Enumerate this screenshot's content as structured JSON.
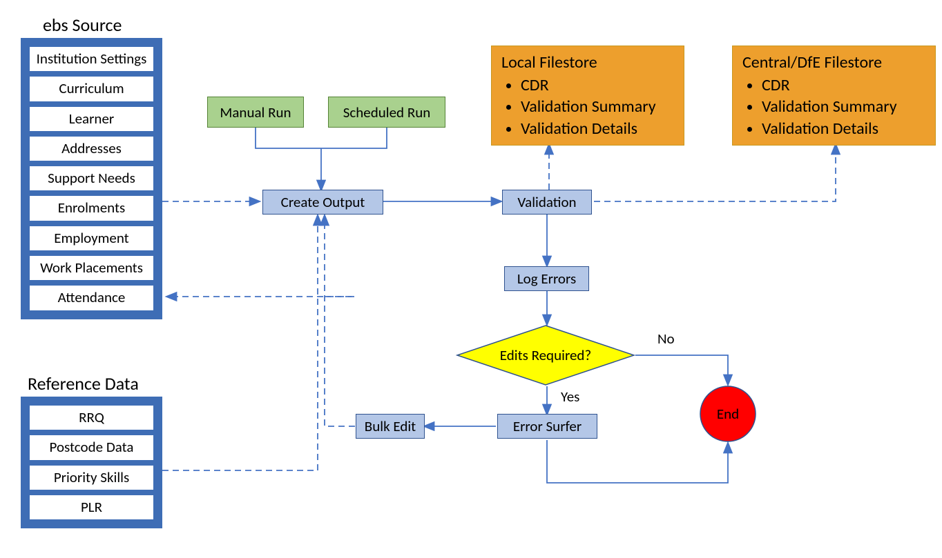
{
  "ebs_source": {
    "title": "ebs Source",
    "items": [
      "Institution Settings",
      "Curriculum",
      "Learner",
      "Addresses",
      "Support Needs",
      "Enrolments",
      "Employment",
      "Work Placements",
      "Attendance"
    ]
  },
  "reference_data": {
    "title": "Reference Data",
    "items": [
      "RRQ",
      "Postcode Data",
      "Priority Skills",
      "PLR"
    ]
  },
  "runs": {
    "manual": "Manual Run",
    "scheduled": "Scheduled Run"
  },
  "process": {
    "create_output": "Create Output",
    "validation": "Validation",
    "log_errors": "Log Errors",
    "decision": "Edits Required?",
    "yes": "Yes",
    "no": "No",
    "error_surfer": "Error Surfer",
    "bulk_edit": "Bulk Edit",
    "end": "End"
  },
  "local_filestore": {
    "title": "Local Filestore",
    "items": [
      "CDR",
      "Validation Summary",
      "Validation Details"
    ]
  },
  "central_filestore": {
    "title": "Central/DfE Filestore",
    "items": [
      "CDR",
      "Validation Summary",
      "Validation Details"
    ]
  }
}
